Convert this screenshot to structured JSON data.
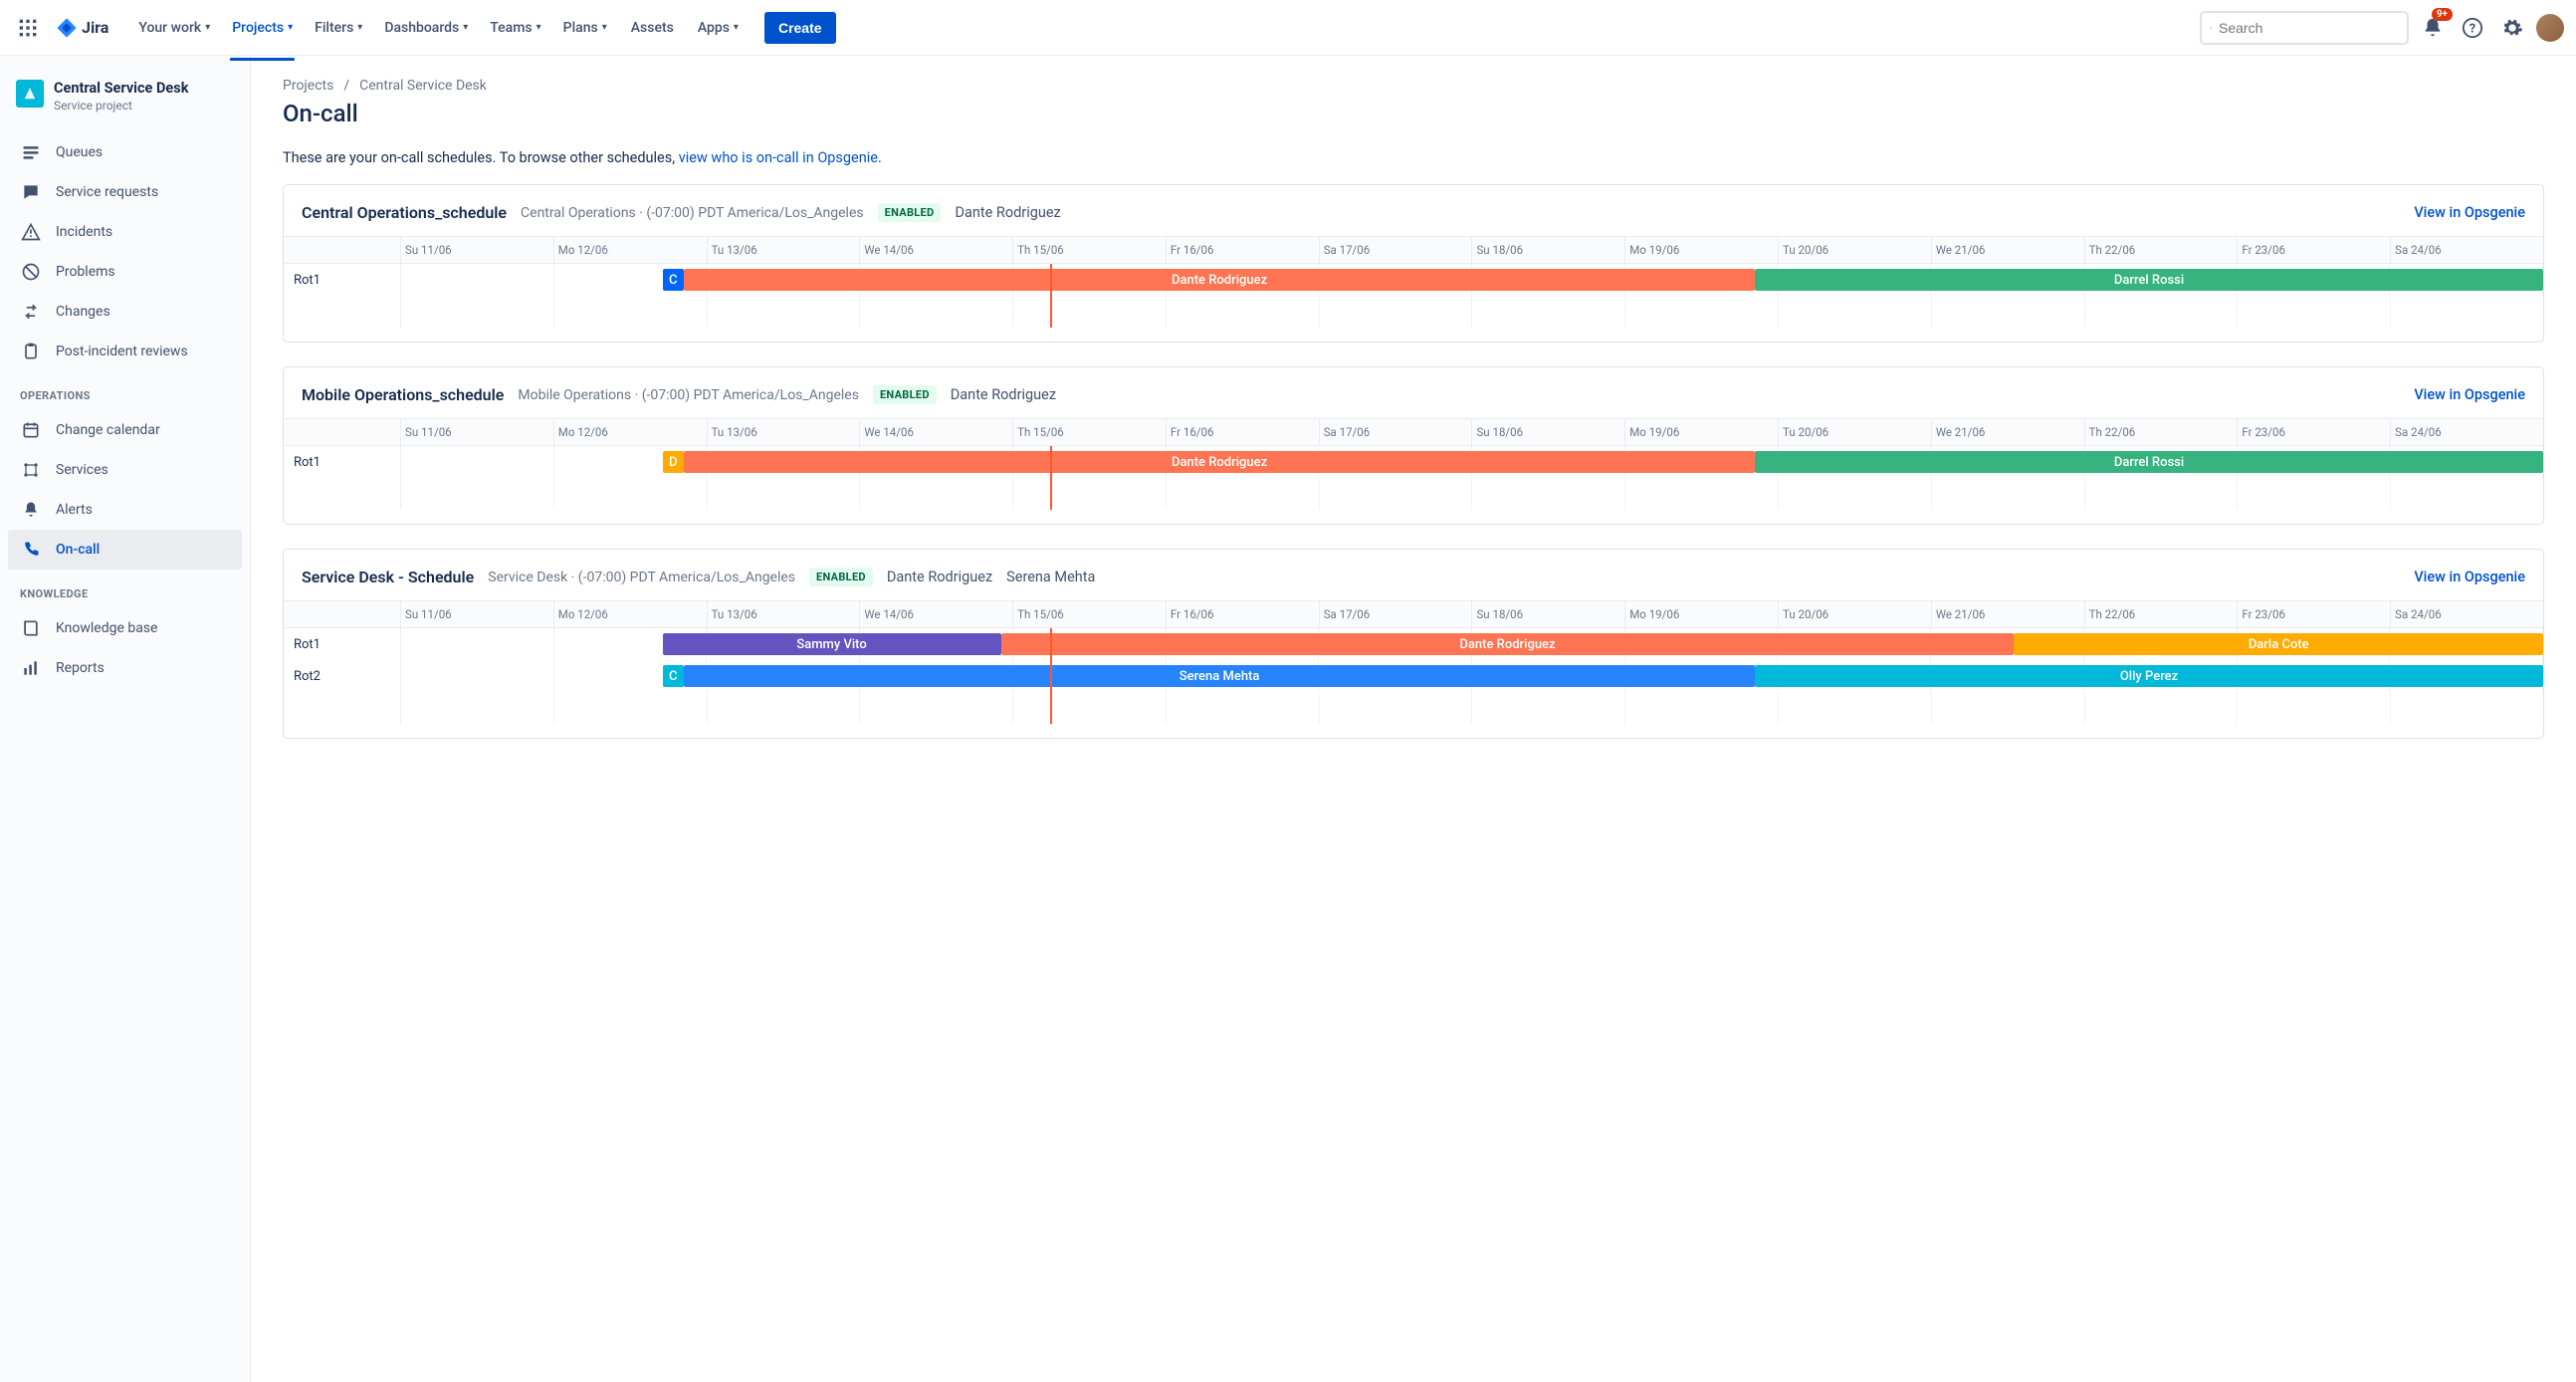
{
  "topnav": {
    "logo_text": "Jira",
    "items": [
      "Your work",
      "Projects",
      "Filters",
      "Dashboards",
      "Teams",
      "Plans",
      "Assets",
      "Apps"
    ],
    "active_index": 1,
    "plain_indices": [
      6
    ],
    "create_label": "Create",
    "search_placeholder": "Search",
    "badge_count": "9+"
  },
  "sidebar": {
    "project_title": "Central Service Desk",
    "project_subtitle": "Service project",
    "items_primary": [
      {
        "label": "Queues",
        "icon": "queues"
      },
      {
        "label": "Service requests",
        "icon": "chat"
      },
      {
        "label": "Incidents",
        "icon": "warning"
      },
      {
        "label": "Problems",
        "icon": "block"
      },
      {
        "label": "Changes",
        "icon": "changes"
      },
      {
        "label": "Post-incident reviews",
        "icon": "clipboard"
      }
    ],
    "section_operations": "OPERATIONS",
    "items_operations": [
      {
        "label": "Change calendar",
        "icon": "calendar"
      },
      {
        "label": "Services",
        "icon": "services"
      },
      {
        "label": "Alerts",
        "icon": "bell"
      },
      {
        "label": "On-call",
        "icon": "phone",
        "active": true
      }
    ],
    "section_knowledge": "KNOWLEDGE",
    "items_knowledge": [
      {
        "label": "Knowledge base",
        "icon": "book"
      },
      {
        "label": "Reports",
        "icon": "chart"
      }
    ]
  },
  "breadcrumb": {
    "root": "Projects",
    "leaf": "Central Service Desk"
  },
  "page_title": "On-call",
  "intro_prefix": "These are your on-call schedules. To browse other schedules, ",
  "intro_link": "view who is on-call in Opsgenie",
  "intro_suffix": ".",
  "days": [
    "Su 11/06",
    "Mo 12/06",
    "Tu 13/06",
    "We 14/06",
    "Th 15/06",
    "Fr 16/06",
    "Sa 17/06",
    "Su 18/06",
    "Mo 19/06",
    "Tu 20/06",
    "We 21/06",
    "Th 22/06",
    "Fr 23/06",
    "Sa 24/06"
  ],
  "now_position_pct": 30.3,
  "schedules": [
    {
      "name": "Central Operations_schedule",
      "meta": "Central Operations · (-07:00) PDT America/Los_Angeles",
      "status": "ENABLED",
      "people": [
        "Dante Rodriguez"
      ],
      "view_label": "View in Opsgenie",
      "rotations": [
        {
          "name": "Rot1",
          "bars": [
            {
              "label": "C",
              "start_pct": 12.2,
              "width_pct": 1.0,
              "color": "#0065FF"
            },
            {
              "label": "Dante Rodriguez",
              "start_pct": 13.2,
              "width_pct": 50.0,
              "color": "#FF7452"
            },
            {
              "label": "Darrel Rossi",
              "start_pct": 63.2,
              "width_pct": 36.8,
              "color": "#36B37E"
            }
          ]
        }
      ],
      "trailing_spacers": 1
    },
    {
      "name": "Mobile Operations_schedule",
      "meta": "Mobile Operations · (-07:00) PDT America/Los_Angeles",
      "status": "ENABLED",
      "people": [
        "Dante Rodriguez"
      ],
      "view_label": "View in Opsgenie",
      "rotations": [
        {
          "name": "Rot1",
          "bars": [
            {
              "label": "D",
              "start_pct": 12.2,
              "width_pct": 1.0,
              "color": "#FFAB00"
            },
            {
              "label": "Dante Rodriguez",
              "start_pct": 13.2,
              "width_pct": 50.0,
              "color": "#FF7452"
            },
            {
              "label": "Darrel Rossi",
              "start_pct": 63.2,
              "width_pct": 36.8,
              "color": "#36B37E"
            }
          ]
        }
      ],
      "trailing_spacers": 1
    },
    {
      "name": "Service Desk - Schedule",
      "meta": "Service Desk · (-07:00) PDT America/Los_Angeles",
      "status": "ENABLED",
      "people": [
        "Dante Rodriguez",
        "Serena Mehta"
      ],
      "view_label": "View in Opsgenie",
      "rotations": [
        {
          "name": "Rot1",
          "bars": [
            {
              "label": "Sammy Vito",
              "start_pct": 12.2,
              "width_pct": 15.8,
              "color": "#6554C0"
            },
            {
              "label": "Dante Rodriguez",
              "start_pct": 28.0,
              "width_pct": 47.3,
              "color": "#FF7452"
            },
            {
              "label": "Darla Cote",
              "start_pct": 75.3,
              "width_pct": 24.7,
              "color": "#FFAB00"
            }
          ]
        },
        {
          "name": "Rot2",
          "bars": [
            {
              "label": "C",
              "start_pct": 12.2,
              "width_pct": 1.0,
              "color": "#00B8D9"
            },
            {
              "label": "Serena Mehta",
              "start_pct": 13.2,
              "width_pct": 50.0,
              "color": "#2684FF"
            },
            {
              "label": "Olly Perez",
              "start_pct": 63.2,
              "width_pct": 36.8,
              "color": "#00B8D9"
            }
          ]
        }
      ],
      "trailing_spacers": 1
    }
  ]
}
